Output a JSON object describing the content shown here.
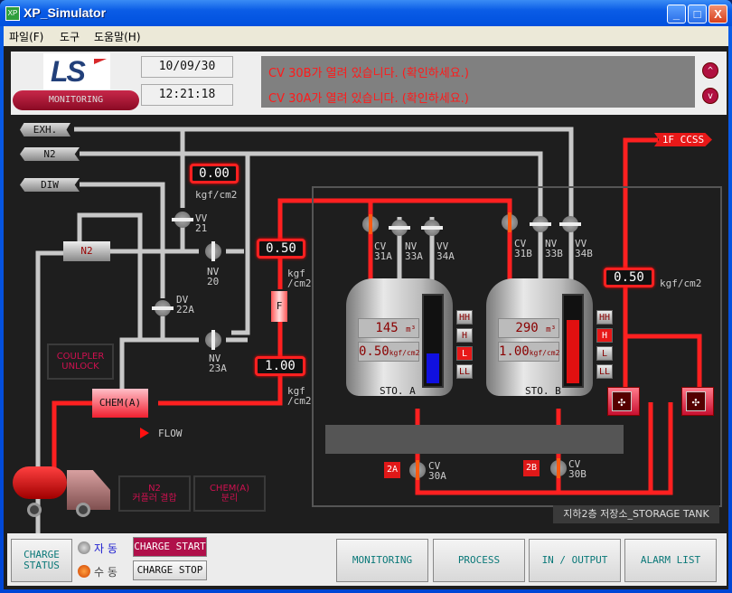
{
  "window": {
    "title": "XP_Simulator",
    "icon": "app-icon",
    "min": "_",
    "max": "□",
    "close": "X"
  },
  "menu": [
    "파일(F)",
    "도구",
    "도움말(H)"
  ],
  "header": {
    "logo": "LS",
    "mode_label": "MONITORING",
    "date": "10/09/30",
    "time": "12:21:18",
    "alarms": [
      "CV 30B가 열려 있습니다. (확인하세요.)",
      "CV 30A가 열려 있습니다. (확인하세요.)"
    ],
    "scroll_up": "^",
    "scroll_down": "v"
  },
  "lines": {
    "exh": "EXH.",
    "n2": "N2",
    "diw": "DIW",
    "ccss": "1F CCSS"
  },
  "pressures": {
    "p1": {
      "value": "0.00",
      "unit": "kgf/cm2"
    },
    "p2": {
      "value": "0.50",
      "unit": "kgf\n/cm2"
    },
    "p3": {
      "value": "1.00",
      "unit": "kgf\n/cm2"
    },
    "p4": {
      "value": "0.50",
      "unit": "kgf/cm2"
    }
  },
  "valves": {
    "vv21": [
      "VV",
      "21"
    ],
    "nv20": [
      "NV",
      "20"
    ],
    "dv22a": [
      "DV",
      "22A"
    ],
    "nv23a": [
      "NV",
      "23A"
    ],
    "cv31a": [
      "CV",
      "31A"
    ],
    "nv33a": [
      "NV",
      "33A"
    ],
    "vv34a": [
      "VV",
      "34A"
    ],
    "cv31b": [
      "CV",
      "31B"
    ],
    "nv33b": [
      "NV",
      "33B"
    ],
    "vv34b": [
      "VV",
      "34B"
    ],
    "cv30a": [
      "CV",
      "30A"
    ],
    "cv30b": [
      "CV",
      "30B"
    ]
  },
  "components": {
    "n2_coupler": "N2",
    "chem_coupler": "CHEM(A)",
    "filter": "F",
    "flow": "FLOW"
  },
  "buttons": {
    "coupler_unlock": [
      "COULPLER",
      "UNLOCK"
    ],
    "n2_coupling": [
      "N2",
      "커플러 결합"
    ],
    "chem_detach": [
      "CHEM(A)",
      "분리"
    ]
  },
  "tanks": [
    {
      "name": "STO. A",
      "volume": "145",
      "vol_unit": "m³",
      "pressure": "0.50",
      "p_unit": "kgf/cm2",
      "level_fraction": 0.35,
      "level_color": "#1010e0",
      "levels": [
        "HH",
        "H",
        "L",
        "LL"
      ],
      "active": "L",
      "bottom_tag": "2A"
    },
    {
      "name": "STO. B",
      "volume": "290",
      "vol_unit": "m³",
      "pressure": "1.00",
      "p_unit": "kgf/cm2",
      "level_fraction": 0.75,
      "level_color": "#e01010",
      "levels": [
        "HH",
        "H",
        "L",
        "LL"
      ],
      "active": "H",
      "bottom_tag": "2B"
    }
  ],
  "storage_label": "지하2층 저장소_STORAGE TANK",
  "footer": {
    "charge_status": [
      "CHARGE",
      "STATUS"
    ],
    "auto": "자  동",
    "manual": "수  동",
    "charge_start": "CHARGE START",
    "charge_stop": "CHARGE STOP",
    "nav": [
      "MONITORING",
      "PROCESS",
      "IN / OUTPUT",
      "ALARM LIST"
    ]
  },
  "colors": {
    "pipe_gray": "#c8c8c8",
    "pipe_red": "#ff2020",
    "accent": "#b01040"
  }
}
